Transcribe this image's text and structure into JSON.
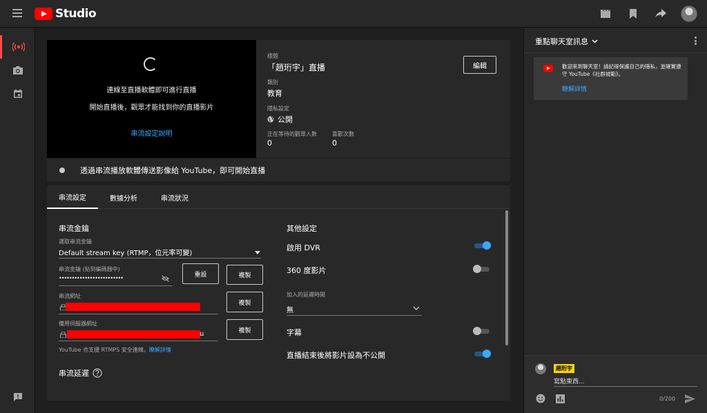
{
  "app": {
    "name": "Studio"
  },
  "stream": {
    "connect_message": "連線至直播軟體即可進行直播",
    "start_message": "開始直播後，觀眾才能找到你的直播影片",
    "setup_help_link": "串流設定說明",
    "title_label": "標題",
    "title_value": "「趙珩宇」直播",
    "category_label": "類別",
    "category_value": "教育",
    "privacy_label": "隱私設定",
    "privacy_value": "公開",
    "waiting_label": "正在等待的觀眾人數",
    "waiting_value": "0",
    "likes_label": "喜歡次數",
    "likes_value": "0",
    "edit_button": "編輯",
    "status_message": "透過串流播放軟體傳送影像給 YouTube，即可開始直播"
  },
  "tabs": [
    {
      "label": "串流設定",
      "active": true
    },
    {
      "label": "數據分析",
      "active": false
    },
    {
      "label": "串流狀況",
      "active": false
    }
  ],
  "settings": {
    "stream_key_title": "串流金鑰",
    "select_key_label": "選取串流金鑰",
    "select_key_value": "Default stream key (RTMP，位元率可變)",
    "key_field_label": "串流金鑰 (貼到編碼器中)",
    "key_masked": "•••••••••••••••••••••••••",
    "reset_button": "重設",
    "copy_button": "複製",
    "url_label": "串流網址",
    "backup_label": "備用伺服器網址",
    "backup_suffix": "u",
    "rtmps_note": "YouTube 也支援 RTMPS 安全連線。",
    "rtmps_link": "瞭解詳情",
    "latency_title": "串流延遲",
    "other_title": "其他設定",
    "dvr_label": "啟用 DVR",
    "dvr_on": true,
    "vr_label": "360 度影片",
    "vr_on": false,
    "delay_label": "加入的延遲時間",
    "delay_value": "無",
    "captions_label": "字幕",
    "captions_on": false,
    "unlist_label": "直播結束後將影片設為不公開",
    "unlist_on": true
  },
  "chat": {
    "title": "重點聊天室訊息",
    "welcome_text": "歡迎來到聊天室！請記得保護自己的隱私，並確實遵守 YouTube《社群規範》。",
    "learn_more": "瞭解詳情",
    "user_name": "趙珩宇",
    "placeholder": "寫點東西...",
    "char_count": "0/200"
  },
  "colors": {
    "accent": "#3ea6ff",
    "brand_red": "#ff0000",
    "badge_yellow": "#ffd600"
  }
}
